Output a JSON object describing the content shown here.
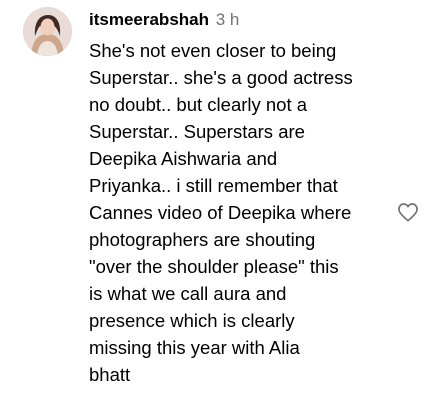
{
  "comment": {
    "username": "itsmeerabshah",
    "time_ago": "3 h",
    "text": "She's not even closer to being\nSuperstar.. she's a good actress\nno doubt.. but clearly not a\nSuperstar.. Superstars are\nDeepika Aishwaria and\nPriyanka.. i still remember that\nCannes video of Deepika where\nphotographers are shouting\n\"over the shoulder please\" this\nis what we call aura and\npresence which is clearly\nmissing this year with Alia\nbhatt",
    "avatar_icon": "profile-photo",
    "like_icon": "heart-outline-icon"
  },
  "colors": {
    "text": "#000000",
    "secondary_text": "#737373",
    "icon": "#737373",
    "background": "#ffffff"
  }
}
